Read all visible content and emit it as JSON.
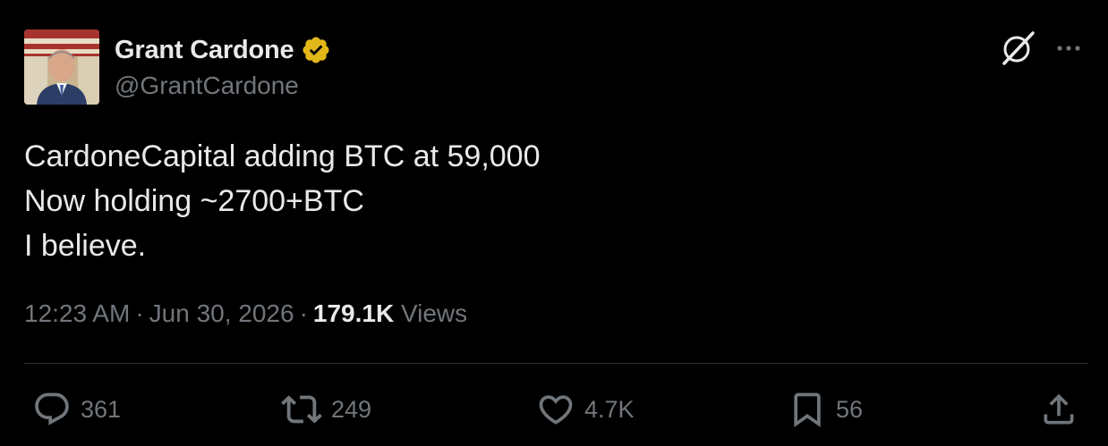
{
  "author": {
    "display_name": "Grant Cardone",
    "handle": "@GrantCardone",
    "verified": true,
    "verified_badge_color": "#e2b719"
  },
  "tweet": {
    "lines": [
      "CardoneCapital adding BTC at 59,000",
      "Now holding ~2700+BTC",
      "I believe."
    ]
  },
  "meta": {
    "time": "12:23 AM",
    "separator": "·",
    "date": "Jun 30, 2026",
    "views_count": "179.1K",
    "views_label": "Views"
  },
  "actions": {
    "replies": "361",
    "reposts": "249",
    "likes": "4.7K",
    "bookmarks": "56"
  },
  "icons": {
    "top_right": [
      "grok-icon",
      "more-icon"
    ],
    "actions": [
      "reply-icon",
      "retweet-icon",
      "heart-icon",
      "bookmark-icon",
      "share-icon"
    ]
  },
  "colors": {
    "background": "#000000",
    "text_primary": "#e7e9ea",
    "text_secondary": "#71767b",
    "divider": "#2f3336"
  }
}
